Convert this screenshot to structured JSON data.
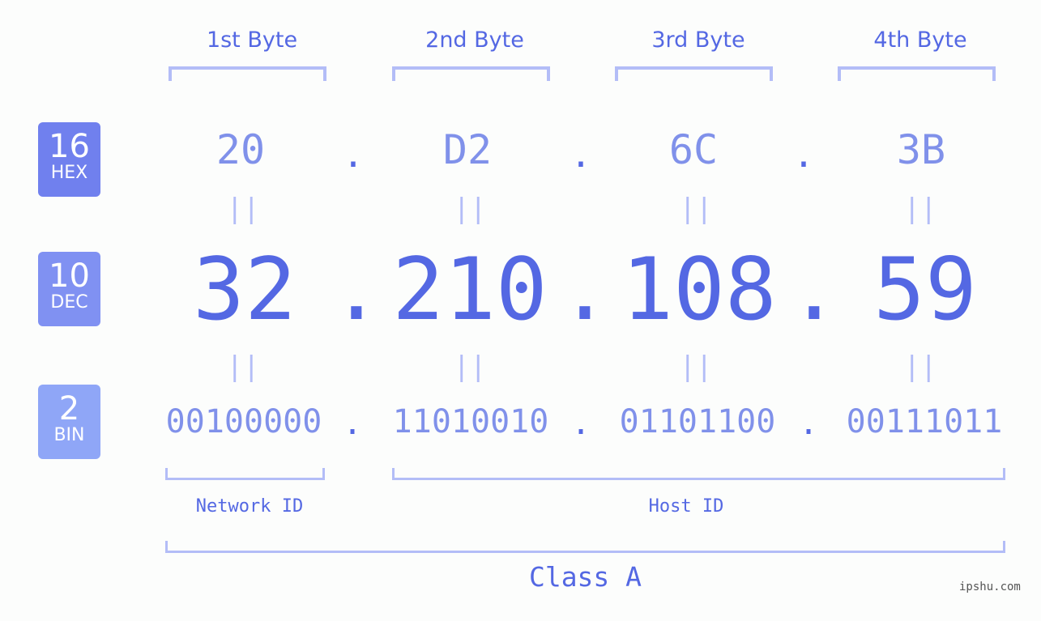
{
  "headers": [
    "1st Byte",
    "2nd Byte",
    "3rd Byte",
    "4th Byte"
  ],
  "badges": [
    {
      "number": "16",
      "label": "HEX",
      "color": "#7080ee"
    },
    {
      "number": "10",
      "label": "DEC",
      "color": "#8091f2"
    },
    {
      "number": "2",
      "label": "BIN",
      "color": "#8fa6f7"
    }
  ],
  "hex": [
    "20",
    "D2",
    "6C",
    "3B"
  ],
  "dec": [
    "32",
    "210",
    "108",
    "59"
  ],
  "bin": [
    "00100000",
    "11010010",
    "01101100",
    "00111011"
  ],
  "separator": ".",
  "equals": "||",
  "network_label": "Network ID",
  "host_label": "Host ID",
  "class_label": "Class A",
  "watermark": "ipshu.com",
  "colors": {
    "primary": "#5468e3",
    "secondary": "#8091ea",
    "light": "#b3bdf7"
  }
}
